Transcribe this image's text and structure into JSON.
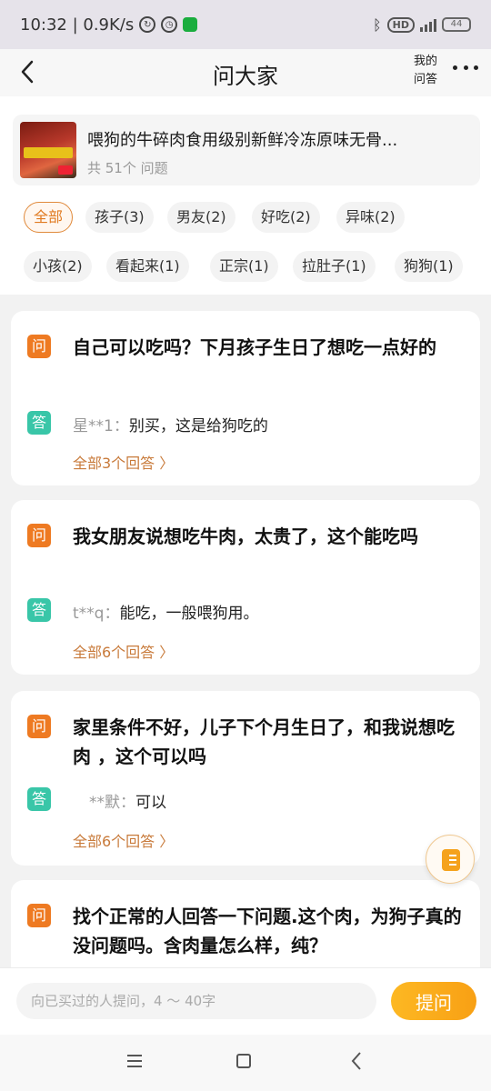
{
  "status_bar": {
    "time_speed": "10:32 | 0.9K/s",
    "battery": "44"
  },
  "header": {
    "title": "问大家",
    "my_answers": "我的问答"
  },
  "product": {
    "name": "喂狗的牛碎肉食用级别新鲜冷冻原味无骨...",
    "count": "共 51个 问题"
  },
  "tags": [
    "全部",
    "孩子(3)",
    "男友(2)",
    "好吃(2)",
    "异味(2)",
    "小孩(2)",
    "看起来(1)",
    "正宗(1)",
    "拉肚子(1)",
    "狗狗(1)"
  ],
  "badges": {
    "question": "问",
    "answer": "答"
  },
  "questions": [
    {
      "title": "自己可以吃吗？下月孩子生日了想吃一点好的",
      "answer_user": "星**1：",
      "answer_text": "别买，这是给狗吃的",
      "all_answers": "全部3个回答 〉"
    },
    {
      "title": "我女朋友说想吃牛肉，太贵了，这个能吃吗",
      "answer_user": "t**q：",
      "answer_text": "能吃，一般喂狗用。",
      "all_answers": "全部6个回答 〉"
    },
    {
      "title": "家里条件不好，儿子下个月生日了，和我说想吃肉 ，这个可以吗",
      "answer_user": "**默：",
      "answer_text": "可以",
      "all_answers": "全部6个回答 〉"
    },
    {
      "title": "找个正常的人回答一下问题.这个肉，为狗子真的没问题吗。含肉量怎么样，纯？"
    }
  ],
  "ask": {
    "placeholder": "向已买过的人提问，4 ～ 40字",
    "button": "提问"
  }
}
